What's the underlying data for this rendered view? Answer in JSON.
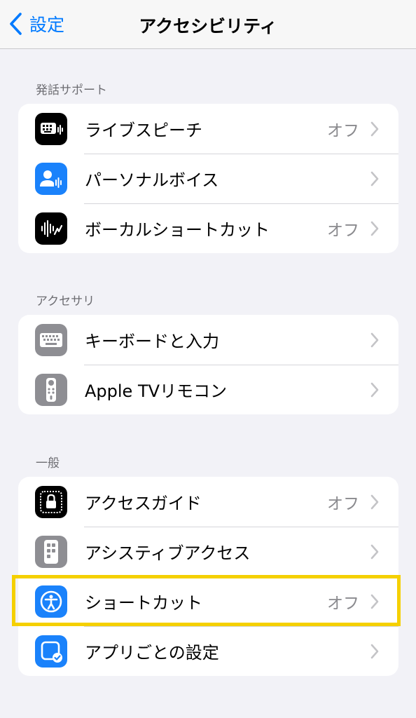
{
  "nav": {
    "back_label": "設定",
    "title": "アクセシビリティ"
  },
  "sections": [
    {
      "header": "発話サポート",
      "rows": [
        {
          "label": "ライブスピーチ",
          "value": "オフ",
          "icon": "keyboard-waveform-icon",
          "icon_bg": "#000000"
        },
        {
          "label": "パーソナルボイス",
          "value": "",
          "icon": "person-waveform-icon",
          "icon_bg": "#1a82fb"
        },
        {
          "label": "ボーカルショートカット",
          "value": "オフ",
          "icon": "waveform-icon",
          "icon_bg": "#000000"
        }
      ]
    },
    {
      "header": "アクセサリ",
      "rows": [
        {
          "label": "キーボードと入力",
          "value": "",
          "icon": "keyboard-icon",
          "icon_bg": "#8e8e93"
        },
        {
          "label": "Apple TVリモコン",
          "value": "",
          "icon": "remote-icon",
          "icon_bg": "#8e8e93"
        }
      ]
    },
    {
      "header": "一般",
      "rows": [
        {
          "label": "アクセスガイド",
          "value": "オフ",
          "icon": "lock-frame-icon",
          "icon_bg": "#000000"
        },
        {
          "label": "アシスティブアクセス",
          "value": "",
          "icon": "assistive-access-icon",
          "icon_bg": "#8e8e93"
        },
        {
          "label": "ショートカット",
          "value": "オフ",
          "icon": "accessibility-icon",
          "icon_bg": "#1a82fb"
        },
        {
          "label": "アプリごとの設定",
          "value": "",
          "icon": "app-settings-icon",
          "icon_bg": "#1a82fb"
        }
      ]
    }
  ],
  "colors": {
    "accent": "#007aff",
    "highlight": "#f5d000",
    "background": "#f2f2f7"
  }
}
